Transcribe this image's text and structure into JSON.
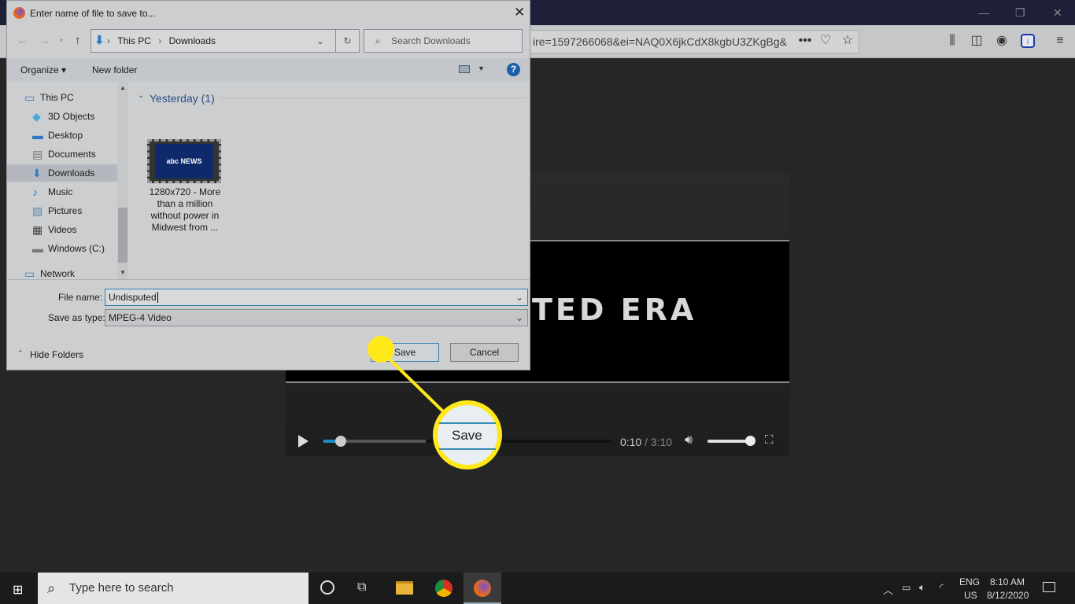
{
  "browser": {
    "url": "ire=1597266068&ei=NAQ0X6jkCdX8kgbU3ZKgBg&",
    "icons": [
      "more-icon",
      "pocket-icon",
      "star-icon",
      "library-icon",
      "sidebar-icon",
      "account-icon",
      "download-icon",
      "menu-icon"
    ]
  },
  "dialog": {
    "title": "Enter name of file to save to...",
    "breadcrumb": [
      "This PC",
      "Downloads"
    ],
    "search_placeholder": "Search Downloads",
    "toolbar": {
      "organize": "Organize ▾",
      "new_folder": "New folder"
    },
    "nav": [
      {
        "label": "This PC",
        "icon": "computer-icon"
      },
      {
        "label": "3D Objects",
        "icon": "cube-icon"
      },
      {
        "label": "Desktop",
        "icon": "desktop-icon"
      },
      {
        "label": "Documents",
        "icon": "document-icon"
      },
      {
        "label": "Downloads",
        "icon": "download-arrow-icon",
        "selected": true
      },
      {
        "label": "Music",
        "icon": "music-icon"
      },
      {
        "label": "Pictures",
        "icon": "picture-icon"
      },
      {
        "label": "Videos",
        "icon": "video-icon"
      },
      {
        "label": "Windows (C:)",
        "icon": "drive-icon"
      },
      {
        "label": "Network",
        "icon": "network-icon"
      }
    ],
    "group_header": "Yesterday (1)",
    "file": {
      "thumb_text": "abc NEWS",
      "name_lines": [
        "1280x720 - More",
        "than a million",
        "without power in",
        "Midwest from ..."
      ]
    },
    "file_name_label": "File name:",
    "file_name_value": "Undisputed",
    "save_type_label": "Save as type:",
    "save_type_value": "MPEG-4 Video",
    "hide_folders": "Hide Folders",
    "save": "Save",
    "cancel": "Cancel"
  },
  "video": {
    "title_text": "TED ERA",
    "current_time": "0:10",
    "duration": "/ 3:10",
    "progress_fraction": 0.053,
    "volume_fraction": 1.0
  },
  "callout": {
    "label": "Save",
    "color": "#ffe81a"
  },
  "taskbar": {
    "search_placeholder": "Type here to search",
    "lang1": "ENG",
    "lang2": "US",
    "time": "8:10 AM",
    "date": "8/12/2020"
  }
}
